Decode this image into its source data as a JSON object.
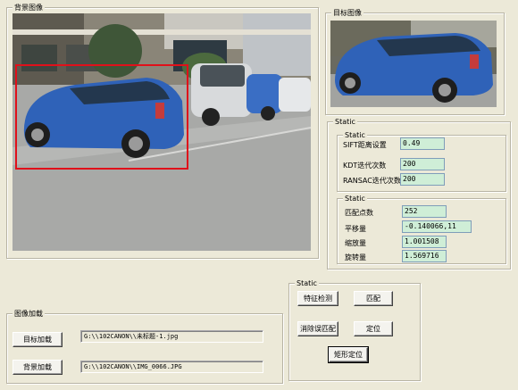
{
  "background_group": {
    "title": "背景图像"
  },
  "target_group": {
    "title": "目标图像"
  },
  "static_outer": {
    "title": "Static"
  },
  "params_group": {
    "title": "Static",
    "sift_label": "SIFT距离设置",
    "sift_value": "0.49",
    "kdt_label": "KDT迭代次数",
    "kdt_value": "200",
    "ransac_label": "RANSAC迭代次数",
    "ransac_value": "200"
  },
  "results_group": {
    "title": "Static",
    "match_count_label": "匹配点数",
    "match_count_value": "252",
    "translation_label": "平移量",
    "translation_value": "-0.140066,11",
    "scale_label": "缩放量",
    "scale_value": "1.001508",
    "rotation_label": "旋转量",
    "rotation_value": "1.569716"
  },
  "load_group": {
    "title": "图像加载",
    "target_button": "目标加载",
    "target_path": "G:\\\\102CANON\\\\未标题-1.jpg",
    "background_button": "背景加载",
    "background_path": "G:\\\\102CANON\\\\IMG_0066.JPG"
  },
  "actions_group": {
    "title": "Static",
    "feature_button": "特征检测",
    "match_button": "匹配",
    "remove_mismatch_button": "消除误匹配",
    "locate_button": "定位",
    "rect_locate_button": "矩形定位"
  },
  "colors": {
    "field_bg": "#cfeed7",
    "window_bg": "#ece9d8",
    "detection_box": "#e0101a"
  },
  "icons": {
    "background_photo": "parking-lot-photo",
    "target_photo": "blue-car-photo"
  }
}
